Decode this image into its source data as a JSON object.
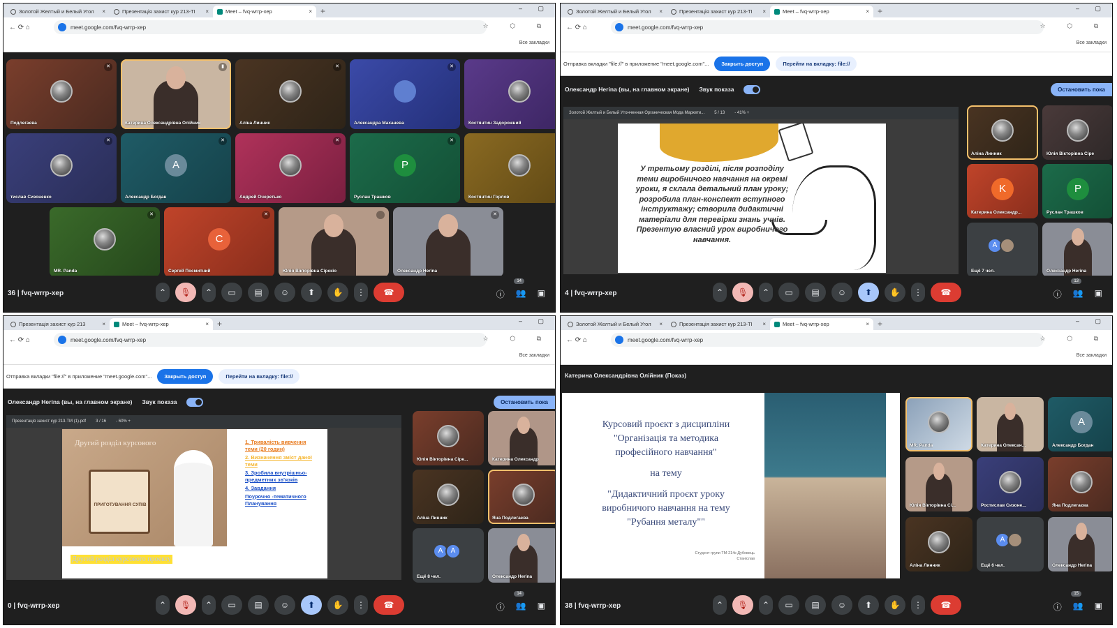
{
  "browser": {
    "tabs_a": [
      "Золотой Желтый и Белый Угол",
      "Презентація захист кур 213-ТІ",
      "Meet – fvq-wrrp-xep"
    ],
    "tabs_b": [
      "Презентація захист кур 213",
      "Meet – fvq-wrrp-xep"
    ],
    "tab_close": "×",
    "new_tab": "+",
    "window_controls": "– ▢",
    "url": "meet.google.com/fvq-wrrp-xep",
    "nav_icons": "← ⟳ ⌂",
    "right_icons": "☆ ⬡ ⧉",
    "bookmarks_label": "Все закладки"
  },
  "share_banner": {
    "text": "Отправка вкладки \"file://\" в приложение \"meet.google.com\"...",
    "stop_label": "Закрыть доступ",
    "goto_label": "Перейти на вкладку: file://"
  },
  "presenter_bar": {
    "name": "Олександр Herіna (вы, на главном экране)",
    "sound_label": "Звук показа",
    "stop_label": "Остановить пока"
  },
  "meeting": {
    "code": "fvq-wrrp-xep",
    "participants_q0": "36",
    "participants_q1": "4",
    "participants_q2": "0",
    "participants_q3": "38",
    "badge_q0": "14",
    "badge_q1": "13",
    "badge_q2": "14",
    "badge_q3": "15",
    "controls": {
      "expand": "⌃",
      "mic_off": "🎙",
      "cam": "▭",
      "captions": "▤",
      "emoji": "☺",
      "present": "⬆",
      "hand": "✋",
      "more": "⋮",
      "end": "☎"
    },
    "right": {
      "info": "ⓘ",
      "people": "👥",
      "chat": "▣"
    }
  },
  "q0": {
    "tiles": [
      {
        "name": "Подлегаєва",
        "mic": "✕"
      },
      {
        "name": "Катерина Олександрівна Олійник",
        "mic": "▮"
      },
      {
        "name": "Аліна Линник",
        "mic": "✕"
      },
      {
        "name": "Александра Маханева",
        "initial": "",
        "mic": "✕"
      },
      {
        "name": "Костянтин Задорожний",
        "mic": ""
      },
      {
        "name": "тислав Сизоненко",
        "mic": "✕"
      },
      {
        "name": "Александр Богдан",
        "initial": "A",
        "mic": "✕"
      },
      {
        "name": "Андрей Очеретько",
        "mic": "✕"
      },
      {
        "name": "Руслан Трашков",
        "initial": "P",
        "mic": "✕"
      },
      {
        "name": "Костянтин Горлов",
        "mic": ""
      },
      {
        "name": "MR. Panda",
        "mic": "✕"
      },
      {
        "name": "Сергей Посмитний",
        "initial": "C",
        "mic": "✕"
      },
      {
        "name": "Юлія Вікторівна Сірекіо",
        "mic": ""
      },
      {
        "name": "Олександр Herіna",
        "mic": "✕"
      }
    ],
    "avatar_a": "A"
  },
  "q1": {
    "pdf_title": "Золотой Желтый и Белый Утонченная Органическая Мода Маркети...",
    "pdf_page": "5 / 13",
    "pdf_zoom": "- 41% +",
    "slide_text": "У третьому розділі, після розподілу теми виробничого навчання на окремі уроки, я склала детальний план уроку; розробила план-конспект вступного інструктажу; створила дидактичні матеріали для перевірки знань учнів. Презентую власний урок виробничого навчання.",
    "tiles": [
      {
        "name": "Аліна Линник"
      },
      {
        "name": "Юлія Вікторівна Сіре"
      },
      {
        "name": "Катерина Олександр...",
        "initial": "K"
      },
      {
        "name": "Руслан Трашков",
        "initial": "P"
      },
      {
        "name": "Ещё 7 чел."
      },
      {
        "name": "Олександр Herіna"
      }
    ],
    "more_initial": "A"
  },
  "q2": {
    "pdf_title": "Презентація захист кур 213-ТМ (1).pdf",
    "pdf_page": "3 / 16",
    "pdf_zoom": "- 60% +",
    "slide_title": "Другий розділ курсового",
    "slide_pot": "ПРИГОТУВАННЯ СУПІВ",
    "slide_highlight": "Другий розділ курсового проекту",
    "list": [
      "1. Тривалість вивчення теми (20 годин)",
      "2. Визначення зміст даної теми",
      "3. Зробила внутрішньо-предметних зв'язків",
      "4. Завдання",
      "Поурочно -тематичного Планування"
    ],
    "tiles": [
      {
        "name": "Юлія Вікторівна Сіре..."
      },
      {
        "name": "Катерина Олександр"
      },
      {
        "name": "Аліна Линник"
      },
      {
        "name": "Яна Подлегаєва"
      },
      {
        "name": "Ещё 8 чел."
      },
      {
        "name": "Олександр Herіna"
      }
    ],
    "more_initials": [
      "A",
      "A"
    ]
  },
  "q3": {
    "presenter": "Катерина Олександрівна Олійник (Показ)",
    "slide_lines": [
      "Курсовий проєкт з дисципліни",
      "\"Організація та методика",
      "професійного навчання\"",
      "на тему",
      "\"Дидактичний проєкт уроку",
      "виробничого навчання на тему",
      "\"Рубання металу\"\""
    ],
    "slide_author": "Студент групи ТМ-214к Дубовець Станіслав",
    "tiles": [
      {
        "name": "MR. Panda"
      },
      {
        "name": "Катерина Олексан..."
      },
      {
        "name": "Александр Богдан",
        "initial": "A"
      },
      {
        "name": "Юлія Вікторівна Сі..."
      },
      {
        "name": "Ростислав Сизоне..."
      },
      {
        "name": "Яна Подлегаєва"
      },
      {
        "name": "Аліна Линник"
      },
      {
        "name": "Ещё 6 чел."
      },
      {
        "name": "Олександр Herіna"
      }
    ],
    "more_initial": "A"
  },
  "colors": {
    "meet_bg": "#1f1f1f",
    "end_call": "#dc3c32",
    "accent": "#1a73e8",
    "mic_off": "#f2b8b5"
  }
}
